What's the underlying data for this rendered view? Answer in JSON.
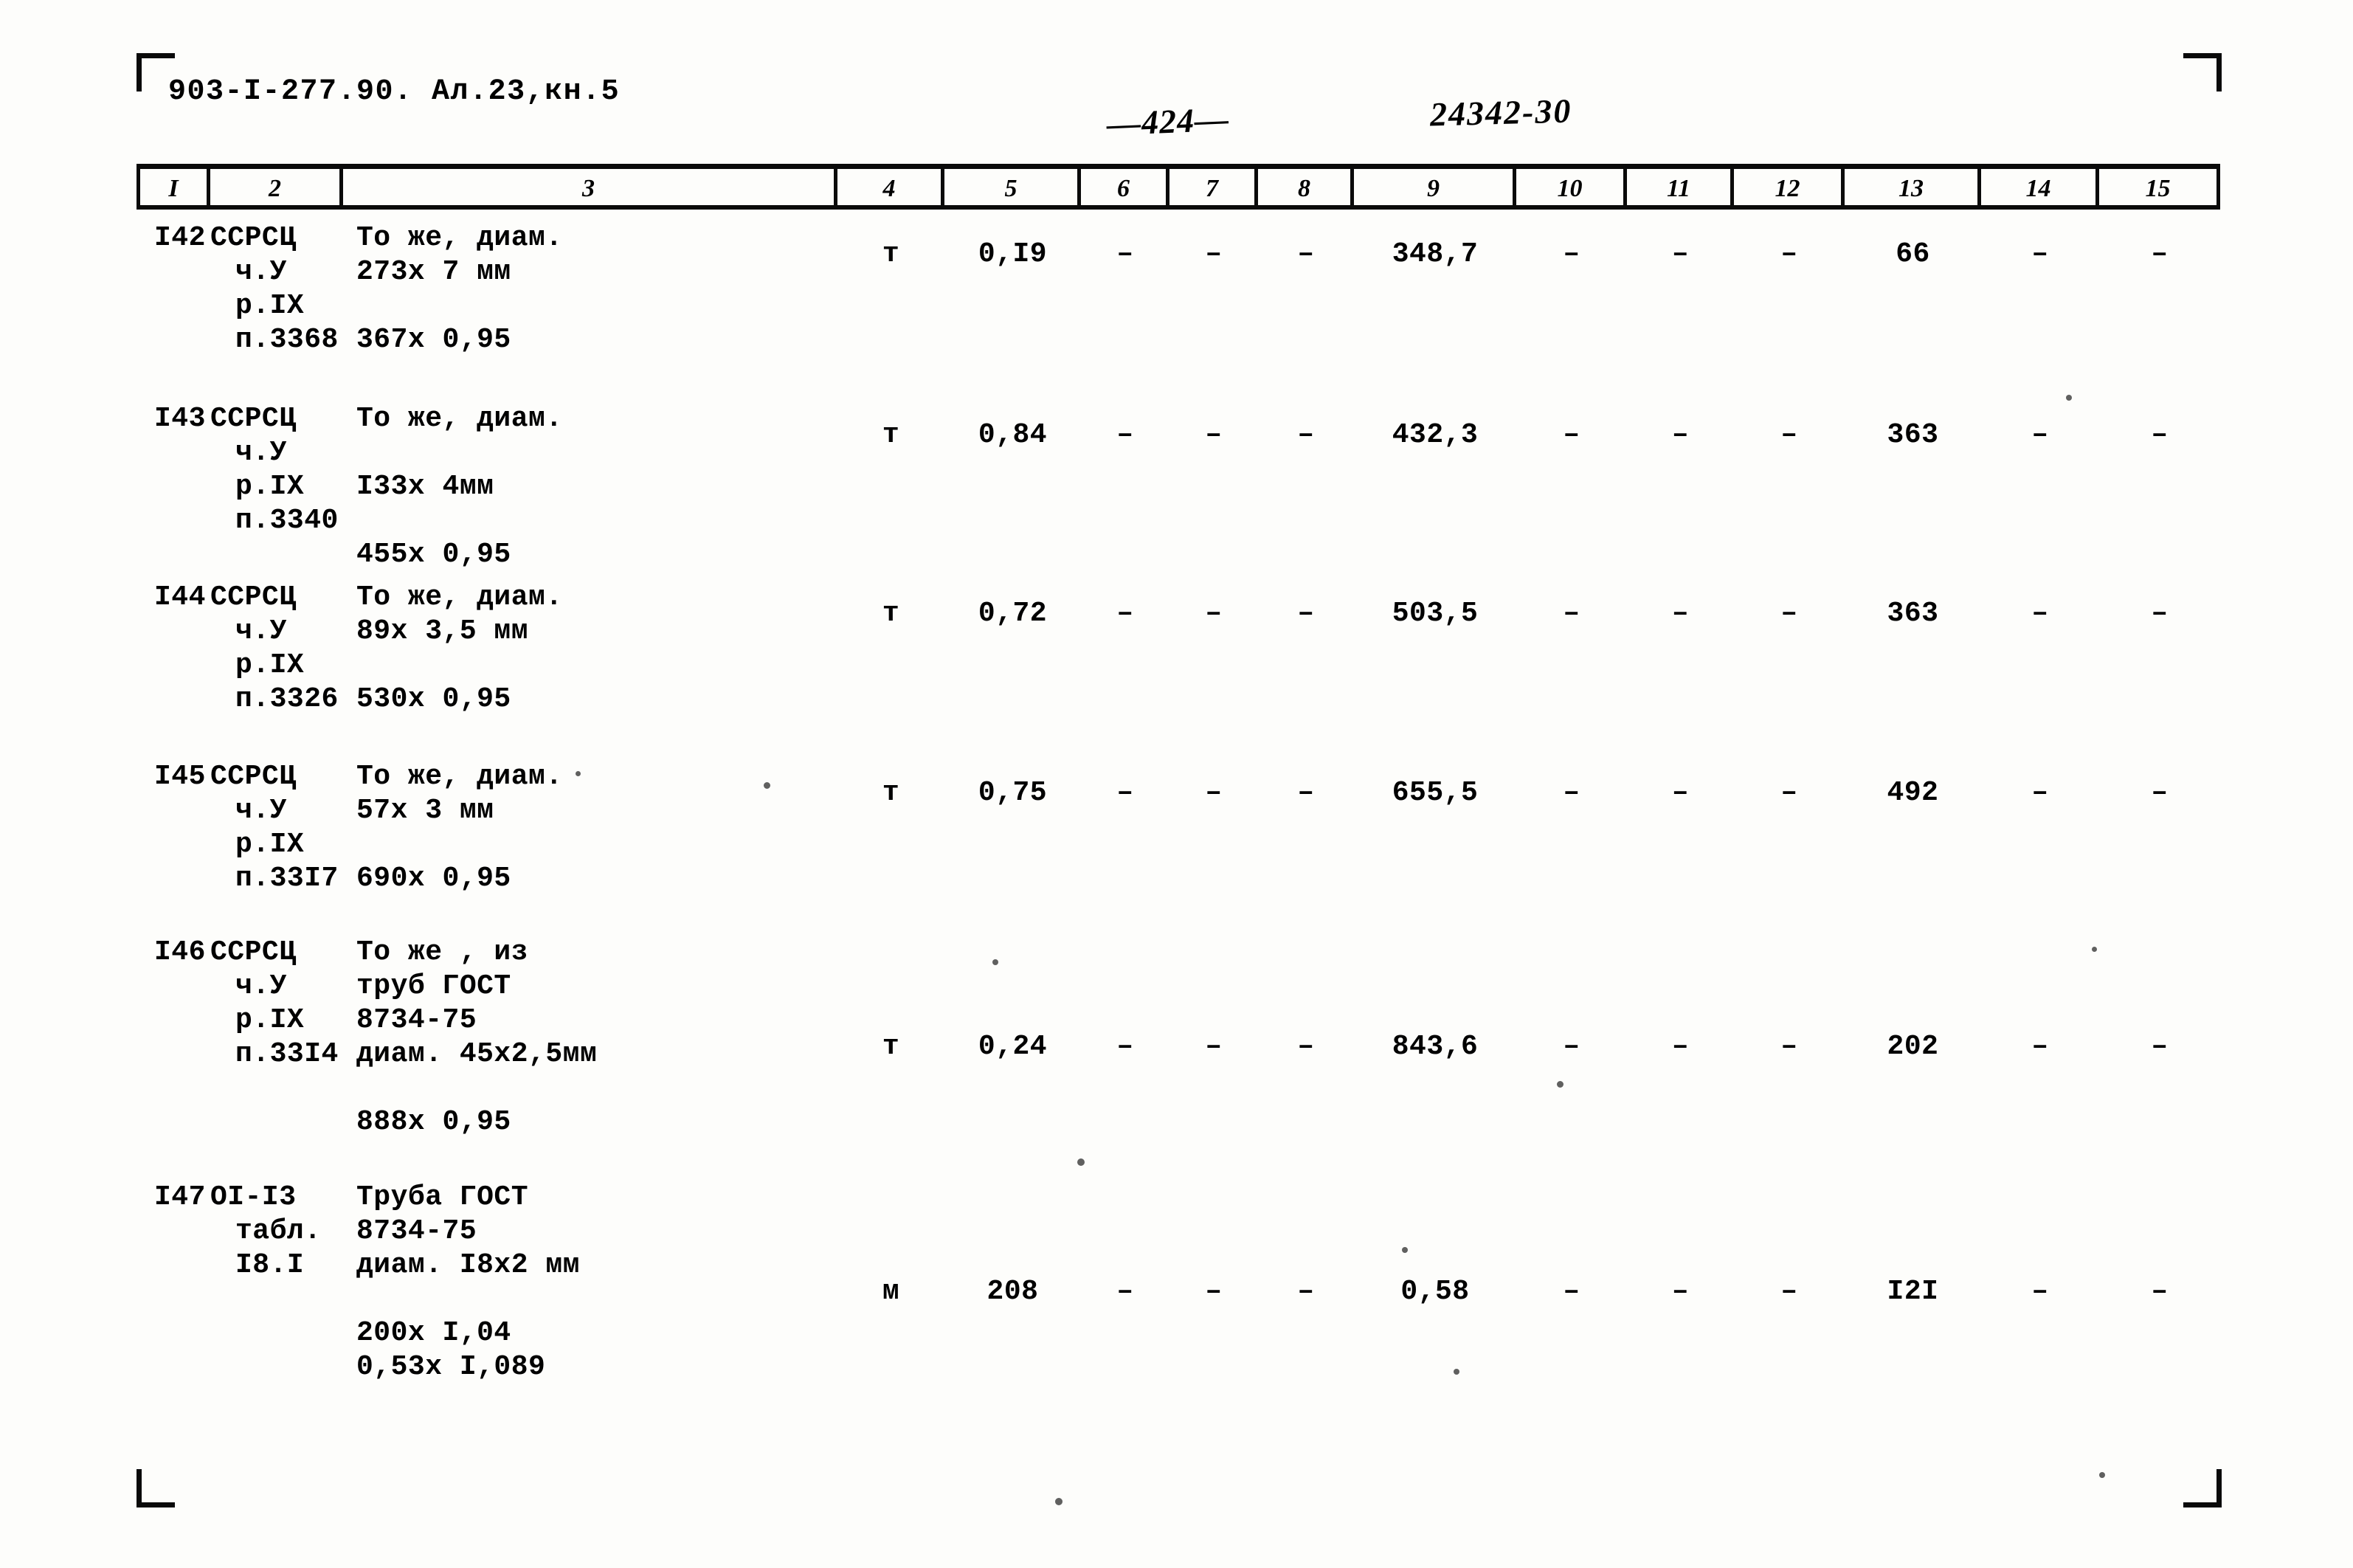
{
  "header": {
    "doc_code": "903-I-277.90. Ал.23,кн.5",
    "page_number": "—424—",
    "stamp_number": "24342-30"
  },
  "table": {
    "column_headers": [
      "I",
      "2",
      "3",
      "4",
      "5",
      "6",
      "7",
      "8",
      "9",
      "10",
      "11",
      "12",
      "13",
      "14",
      "15"
    ],
    "rows": [
      {
        "num": "I42",
        "code_lines": [
          "ССРСЦ",
          "ч.У",
          "р.IX",
          "п.3368"
        ],
        "desc_lines": [
          "То же, диам.",
          "273х 7 мм",
          "",
          "367х 0,95"
        ],
        "unit": "т",
        "c5": "0,I9",
        "c6": "–",
        "c7": "–",
        "c8": "–",
        "c9": "348,7",
        "c10": "–",
        "c11": "–",
        "c12": "–",
        "c13": "66",
        "c14": "–",
        "c15": "–"
      },
      {
        "num": "I43",
        "code_lines": [
          "ССРСЦ",
          "ч.У",
          "р.IX",
          "п.3340"
        ],
        "desc_lines": [
          "То же, диам.",
          "",
          "I33х 4мм",
          "",
          "455х 0,95"
        ],
        "unit": "т",
        "c5": "0,84",
        "c6": "–",
        "c7": "–",
        "c8": "–",
        "c9": "432,3",
        "c10": "–",
        "c11": "–",
        "c12": "–",
        "c13": "363",
        "c14": "–",
        "c15": "–"
      },
      {
        "num": "I44",
        "code_lines": [
          "ССРСЦ",
          "ч.У",
          "р.IX",
          "п.3326"
        ],
        "desc_lines": [
          "То же, диам.",
          "89х 3,5 мм",
          "",
          "530х 0,95"
        ],
        "unit": "т",
        "c5": "0,72",
        "c6": "–",
        "c7": "–",
        "c8": "–",
        "c9": "503,5",
        "c10": "–",
        "c11": "–",
        "c12": "–",
        "c13": "363",
        "c14": "–",
        "c15": "–"
      },
      {
        "num": "I45",
        "code_lines": [
          "ССРСЦ",
          "ч.У",
          "р.IX",
          "п.33I7"
        ],
        "desc_lines": [
          "То же, диам.",
          "57х 3 мм",
          "",
          "690х 0,95"
        ],
        "unit": "т",
        "c5": "0,75",
        "c6": "–",
        "c7": "–",
        "c8": "–",
        "c9": "655,5",
        "c10": "–",
        "c11": "–",
        "c12": "–",
        "c13": "492",
        "c14": "–",
        "c15": "–"
      },
      {
        "num": "I46",
        "code_lines": [
          "ССРСЦ",
          "ч.У",
          "р.IX",
          "п.33I4"
        ],
        "desc_lines": [
          "То же , из",
          "труб ГОСТ",
          "8734-75",
          "диам. 45х2,5мм",
          "",
          "888х 0,95"
        ],
        "unit": "т",
        "c5": "0,24",
        "c6": "–",
        "c7": "–",
        "c8": "–",
        "c9": "843,6",
        "c10": "–",
        "c11": "–",
        "c12": "–",
        "c13": "202",
        "c14": "–",
        "c15": "–"
      },
      {
        "num": "I47",
        "code_lines": [
          "OI-I3",
          "табл.",
          "I8.I"
        ],
        "desc_lines": [
          "Труба ГОСТ",
          "8734-75",
          "диам. I8х2 мм",
          "",
          "200х I,04",
          "0,53х I,089"
        ],
        "unit": "м",
        "c5": "208",
        "c6": "–",
        "c7": "–",
        "c8": "–",
        "c9": "0,58",
        "c10": "–",
        "c11": "–",
        "c12": "–",
        "c13": "I2I",
        "c14": "–",
        "c15": "–"
      }
    ]
  }
}
